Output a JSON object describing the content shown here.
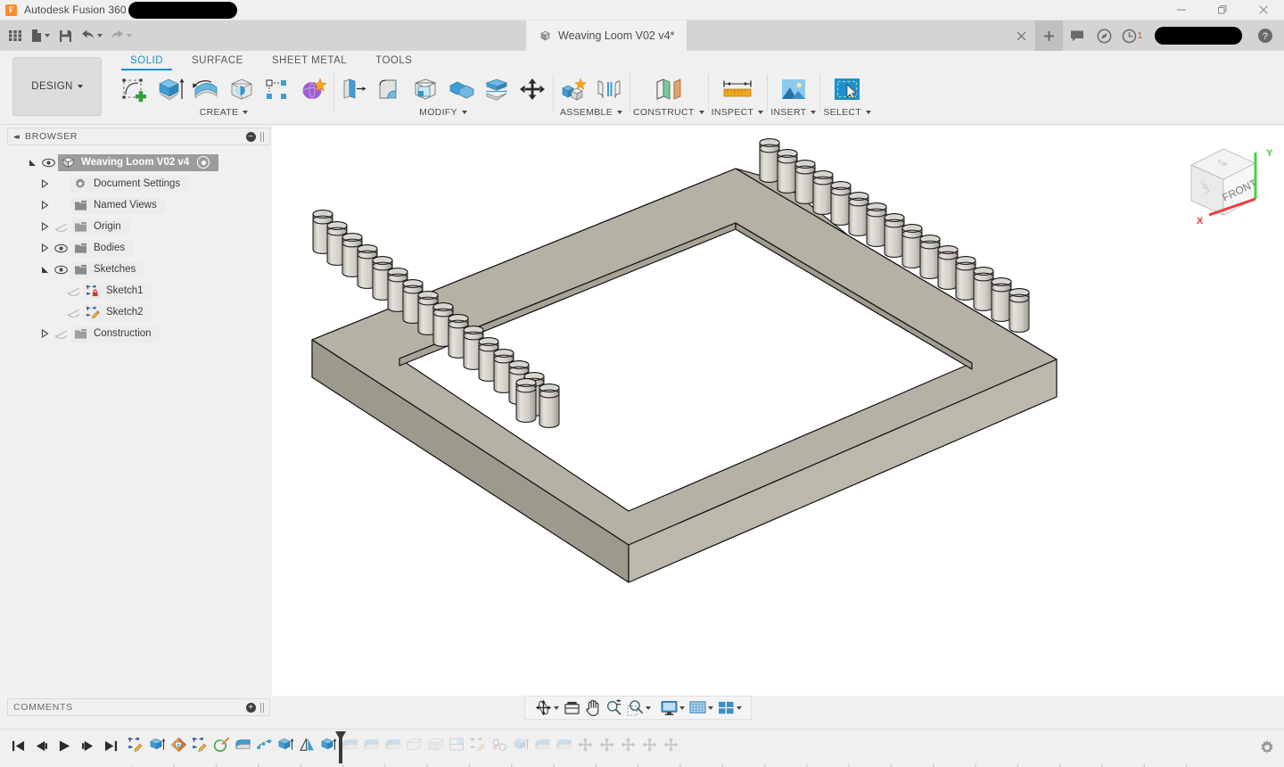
{
  "app": {
    "name": "Autodesk Fusion 360",
    "logo_letter": "F",
    "title_redacted": true
  },
  "window_controls": [
    {
      "name": "minimize",
      "label": "Minimize"
    },
    {
      "name": "restore",
      "label": "Restore"
    },
    {
      "name": "close",
      "label": "Close"
    }
  ],
  "quick_access": {
    "left_buttons": [
      {
        "name": "show-data-panel-button",
        "icon": "grid-icon",
        "label": "Show Data Panel",
        "dropdown": false,
        "dim": false
      },
      {
        "name": "file-button",
        "icon": "file-icon",
        "label": "File",
        "dropdown": true,
        "dim": false
      },
      {
        "name": "save-button",
        "icon": "save-icon",
        "label": "Save",
        "dropdown": false,
        "dim": false
      },
      {
        "name": "undo-button",
        "icon": "undo-icon",
        "label": "Undo",
        "dropdown": true,
        "dim": false
      },
      {
        "name": "redo-button",
        "icon": "redo-icon",
        "label": "Redo",
        "dropdown": true,
        "dim": true
      }
    ],
    "document_tab": {
      "label": "Weaving Loom V02 v4*",
      "icon": "cube-icon",
      "close_label": "×"
    },
    "right_buttons": [
      {
        "name": "close-tab-button",
        "icon": "close-icon",
        "label": "×"
      },
      {
        "name": "new-tab-button",
        "icon": "plus-icon",
        "label": "+"
      },
      {
        "name": "comments-button",
        "icon": "comment-icon",
        "label": "Comments"
      },
      {
        "name": "extensions-button",
        "icon": "extensions-icon",
        "label": "Extensions"
      },
      {
        "name": "job-status-button",
        "icon": "clock-icon",
        "label": "Job Status",
        "badge": "1"
      }
    ],
    "user_redacted": true,
    "help_button": {
      "name": "help-button",
      "icon": "help-icon",
      "label": "?"
    }
  },
  "ribbon": {
    "workspace_button": {
      "label": "DESIGN",
      "dropdown": true
    },
    "tabs": [
      {
        "label": "SOLID",
        "active": true
      },
      {
        "label": "SURFACE",
        "active": false
      },
      {
        "label": "SHEET METAL",
        "active": false
      },
      {
        "label": "TOOLS",
        "active": false
      }
    ],
    "panels": [
      {
        "label": "CREATE",
        "dropdown": true,
        "separator": false,
        "buttons": [
          {
            "name": "create-sketch-button",
            "icon": "create-sketch-icon",
            "label": "Create Sketch"
          },
          {
            "name": "extrude-button",
            "icon": "extrude-icon",
            "label": "Extrude"
          },
          {
            "name": "revolve-button",
            "icon": "revolve-icon",
            "label": "Revolve"
          },
          {
            "name": "sphere-button",
            "icon": "sphere-icon",
            "label": "Sphere"
          },
          {
            "name": "pattern-button",
            "icon": "pattern-icon",
            "label": "Pattern"
          },
          {
            "name": "create-form-button",
            "icon": "form-icon",
            "label": "Create Form"
          }
        ]
      },
      {
        "label": "MODIFY",
        "dropdown": true,
        "separator": true,
        "buttons": [
          {
            "name": "press-pull-button",
            "icon": "press-pull-icon",
            "label": "Press Pull"
          },
          {
            "name": "fillet-button",
            "icon": "fillet-icon",
            "label": "Fillet"
          },
          {
            "name": "shell-button",
            "icon": "shell-icon",
            "label": "Shell"
          },
          {
            "name": "combine-button",
            "icon": "combine-icon",
            "label": "Combine"
          },
          {
            "name": "split-face-button",
            "icon": "split-face-icon",
            "label": "Split Face"
          },
          {
            "name": "move-copy-button",
            "icon": "move-copy-icon",
            "label": "Move/Copy"
          }
        ]
      },
      {
        "label": "ASSEMBLE",
        "dropdown": true,
        "separator": true,
        "buttons": [
          {
            "name": "new-component-button",
            "icon": "new-component-icon",
            "label": "New Component"
          },
          {
            "name": "joint-button",
            "icon": "joint-icon",
            "label": "Joint"
          }
        ]
      },
      {
        "label": "CONSTRUCT",
        "dropdown": true,
        "separator": true,
        "buttons": [
          {
            "name": "offset-plane-button",
            "icon": "offset-plane-icon",
            "label": "Offset Plane"
          }
        ]
      },
      {
        "label": "INSPECT",
        "dropdown": true,
        "separator": true,
        "buttons": [
          {
            "name": "measure-button",
            "icon": "measure-icon",
            "label": "Measure"
          }
        ]
      },
      {
        "label": "INSERT",
        "dropdown": true,
        "separator": true,
        "buttons": [
          {
            "name": "insert-image-button",
            "icon": "insert-image-icon",
            "label": "Insert Image"
          }
        ]
      },
      {
        "label": "SELECT",
        "dropdown": true,
        "separator": true,
        "buttons": [
          {
            "name": "select-button",
            "icon": "select-icon",
            "label": "Select"
          }
        ]
      }
    ]
  },
  "browser": {
    "header": {
      "title": "BROWSER",
      "collapse_label": "◂◂",
      "settings_label": "−"
    },
    "items": [
      {
        "name": "browser-item-root",
        "label": "Weaving Loom V02 v4",
        "indent": 0,
        "expander": "expanded",
        "visibility": "on",
        "icon": "component-icon",
        "selected": true,
        "activate_dot": true
      },
      {
        "name": "browser-item-document-settings",
        "label": "Document Settings",
        "indent": 1,
        "expander": "collapsed",
        "visibility": "none",
        "icon": "gear-icon",
        "selected": false,
        "activate_dot": false
      },
      {
        "name": "browser-item-named-views",
        "label": "Named Views",
        "indent": 1,
        "expander": "collapsed",
        "visibility": "none",
        "icon": "folder-icon",
        "selected": false,
        "activate_dot": false
      },
      {
        "name": "browser-item-origin",
        "label": "Origin",
        "indent": 1,
        "expander": "collapsed",
        "visibility": "off",
        "icon": "folder-icon",
        "selected": false,
        "activate_dot": false
      },
      {
        "name": "browser-item-bodies",
        "label": "Bodies",
        "indent": 1,
        "expander": "collapsed",
        "visibility": "on",
        "icon": "folder-icon",
        "selected": false,
        "activate_dot": false
      },
      {
        "name": "browser-item-sketches",
        "label": "Sketches",
        "indent": 1,
        "expander": "expanded",
        "visibility": "on",
        "icon": "folder-icon",
        "selected": false,
        "activate_dot": false
      },
      {
        "name": "browser-item-sketch1",
        "label": "Sketch1",
        "indent": 2,
        "expander": "none",
        "visibility": "off",
        "icon": "sketch-locked-icon",
        "selected": false,
        "activate_dot": false
      },
      {
        "name": "browser-item-sketch2",
        "label": "Sketch2",
        "indent": 2,
        "expander": "none",
        "visibility": "off",
        "icon": "sketch-edit-icon",
        "selected": false,
        "activate_dot": false
      },
      {
        "name": "browser-item-construction",
        "label": "Construction",
        "indent": 1,
        "expander": "collapsed",
        "visibility": "off",
        "icon": "folder-icon",
        "selected": false,
        "activate_dot": false
      }
    ]
  },
  "viewcube": {
    "front_label": "FRONT",
    "top_label": "TOP",
    "left_label": "LEFT",
    "axis_x_label": "X",
    "axis_y_label": "Y",
    "axis_x_color": "#ee3b3b",
    "axis_y_color": "#3fd43f"
  },
  "comments": {
    "title": "COMMENTS",
    "add_label": "+"
  },
  "navbar": {
    "buttons": [
      {
        "name": "orbit-button",
        "icon": "orbit-icon",
        "label": "Orbit",
        "dropdown": true
      },
      {
        "name": "look-at-button",
        "icon": "look-at-icon",
        "label": "Look At",
        "dropdown": false
      },
      {
        "name": "pan-button",
        "icon": "pan-hand-icon",
        "label": "Pan",
        "dropdown": false
      },
      {
        "name": "zoom-button",
        "icon": "zoom-icon",
        "label": "Zoom",
        "dropdown": false
      },
      {
        "name": "fit-button",
        "icon": "zoom-window-icon",
        "label": "Fit",
        "dropdown": true
      },
      {
        "name": "display-settings-button",
        "icon": "monitor-icon",
        "label": "Display Settings",
        "dropdown": true
      },
      {
        "name": "grid-snaps-button",
        "icon": "grid-snap-icon",
        "label": "Grid and Snaps",
        "dropdown": true
      },
      {
        "name": "viewports-button",
        "icon": "viewports-icon",
        "label": "Viewports",
        "dropdown": true
      }
    ]
  },
  "timeline": {
    "playback": [
      {
        "name": "go-to-beginning-button",
        "icon": "skip-start-icon",
        "label": "Go to Beginning"
      },
      {
        "name": "step-back-button",
        "icon": "step-back-icon",
        "label": "Step Back"
      },
      {
        "name": "play-button",
        "icon": "play-icon",
        "label": "Play"
      },
      {
        "name": "step-forward-button",
        "icon": "step-forward-icon",
        "label": "Step Forward"
      },
      {
        "name": "go-to-end-button",
        "icon": "skip-end-icon",
        "label": "Go to End"
      }
    ],
    "playhead_index": 10,
    "features": [
      {
        "name": "timeline-feature-sketch",
        "icon": "sketch-edit-icon",
        "label": "Sketch",
        "state": "past"
      },
      {
        "name": "timeline-feature-extrude",
        "icon": "extrude-icon",
        "label": "Extrude",
        "state": "past"
      },
      {
        "name": "timeline-feature-appearance",
        "icon": "appearance-icon",
        "label": "Appearance",
        "state": "past"
      },
      {
        "name": "timeline-feature-sketch-2",
        "icon": "sketch-edit-icon",
        "label": "Sketch",
        "state": "past"
      },
      {
        "name": "timeline-feature-coil",
        "icon": "coil-icon",
        "label": "Coil",
        "state": "past"
      },
      {
        "name": "timeline-feature-fillet",
        "icon": "fillet-icon",
        "label": "Fillet",
        "state": "past"
      },
      {
        "name": "timeline-feature-pattern-path",
        "icon": "pattern-path-icon",
        "label": "Pattern on Path",
        "state": "past"
      },
      {
        "name": "timeline-feature-extrude-2",
        "icon": "extrude-icon",
        "label": "Extrude",
        "state": "past"
      },
      {
        "name": "timeline-feature-mirror",
        "icon": "mirror-icon",
        "label": "Mirror",
        "state": "past"
      },
      {
        "name": "timeline-feature-extrude-3",
        "icon": "extrude-icon",
        "label": "Extrude",
        "state": "past"
      },
      {
        "name": "timeline-feature-fillet-2",
        "icon": "fillet-icon",
        "label": "Fillet",
        "state": "future"
      },
      {
        "name": "timeline-feature-fillet-3",
        "icon": "fillet-icon",
        "label": "Fillet",
        "state": "future"
      },
      {
        "name": "timeline-feature-fillet-4",
        "icon": "fillet-icon",
        "label": "Fillet",
        "state": "future"
      },
      {
        "name": "timeline-feature-chamfer",
        "icon": "chamfer-icon",
        "label": "Chamfer",
        "state": "future"
      },
      {
        "name": "timeline-feature-shell",
        "icon": "shell-icon",
        "label": "Shell",
        "state": "future"
      },
      {
        "name": "timeline-feature-split",
        "icon": "split-icon",
        "label": "Split Body",
        "state": "future"
      },
      {
        "name": "timeline-feature-sketch-3",
        "icon": "sketch-edit-icon",
        "label": "Sketch",
        "state": "future"
      },
      {
        "name": "timeline-feature-thread",
        "icon": "thread-icon",
        "label": "Thread",
        "state": "future"
      },
      {
        "name": "timeline-feature-extrude-4",
        "icon": "extrude-icon",
        "label": "Extrude",
        "state": "future"
      },
      {
        "name": "timeline-feature-fillet-5",
        "icon": "fillet-icon",
        "label": "Fillet",
        "state": "future"
      },
      {
        "name": "timeline-feature-fillet-6",
        "icon": "fillet-icon",
        "label": "Fillet",
        "state": "future"
      },
      {
        "name": "timeline-feature-move-1",
        "icon": "move-copy-icon",
        "label": "Move/Copy",
        "state": "future"
      },
      {
        "name": "timeline-feature-move-2",
        "icon": "move-copy-icon",
        "label": "Move/Copy",
        "state": "future"
      },
      {
        "name": "timeline-feature-move-3",
        "icon": "move-copy-icon",
        "label": "Move/Copy",
        "state": "future"
      },
      {
        "name": "timeline-feature-move-4",
        "icon": "move-copy-icon",
        "label": "Move/Copy",
        "state": "future"
      },
      {
        "name": "timeline-feature-move-5",
        "icon": "move-copy-icon",
        "label": "Move/Copy",
        "state": "future"
      }
    ],
    "settings_button": {
      "name": "timeline-settings-button",
      "icon": "gear-icon",
      "label": "Timeline Settings"
    }
  },
  "model": {
    "description": "Weaving loom rectangular frame with cylindrical pegs",
    "body_color": "#b2aea1",
    "body_color_light": "#c6c3b9",
    "body_color_dark": "#9d998c",
    "peg_color": "#cbc9c2",
    "edge_color": "#1a1a1a",
    "pegs_left_edge": 17,
    "pegs_right_edge": 15
  }
}
